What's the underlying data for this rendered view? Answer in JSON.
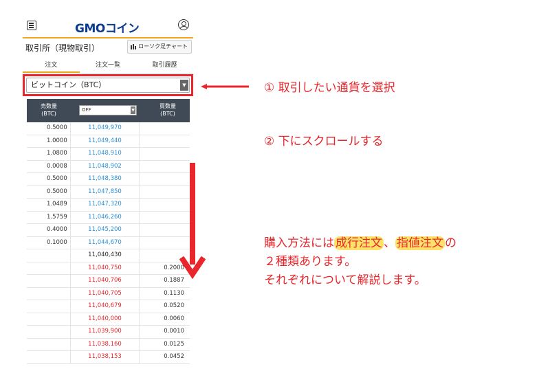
{
  "app": {
    "logo": "GMOコイン",
    "page_title": "取引所（現物取引）",
    "chart_button": "ローソク足チャート"
  },
  "tabs": [
    "注文",
    "注文一覧",
    "取引履歴"
  ],
  "pair": {
    "value": "ビットコイン（BTC）"
  },
  "orderbook": {
    "sell_header": [
      "売数量",
      "(BTC)"
    ],
    "buy_header": [
      "買数量",
      "(BTC)"
    ],
    "filter_value": "OFF",
    "asks": [
      {
        "qty": "0.5000",
        "price": "11,049,970"
      },
      {
        "qty": "1.0000",
        "price": "11,049,440"
      },
      {
        "qty": "1.0800",
        "price": "11,048,910"
      },
      {
        "qty": "0.0008",
        "price": "11,048,902"
      },
      {
        "qty": "0.5000",
        "price": "11,048,380"
      },
      {
        "qty": "0.5000",
        "price": "11,047,850"
      },
      {
        "qty": "1.0489",
        "price": "11,047,320"
      },
      {
        "qty": "1.5759",
        "price": "11,046,260"
      },
      {
        "qty": "0.4000",
        "price": "11,045,200"
      },
      {
        "qty": "0.1000",
        "price": "11,044,670"
      }
    ],
    "mid_price": "11,040,430",
    "bids": [
      {
        "price": "11,040,750",
        "qty": "0.2000"
      },
      {
        "price": "11,040,706",
        "qty": "0.1887"
      },
      {
        "price": "11,040,705",
        "qty": "0.1130"
      },
      {
        "price": "11,040,679",
        "qty": "0.0520"
      },
      {
        "price": "11,040,000",
        "qty": "0.0060"
      },
      {
        "price": "11,039,900",
        "qty": "0.0010"
      },
      {
        "price": "11,038,160",
        "qty": "0.0125"
      },
      {
        "price": "11,038,153",
        "qty": "0.0452"
      }
    ]
  },
  "annotations": {
    "step1": "①  取引したい通貨を選択",
    "step2": "②  下にスクロールする",
    "desc_prefix": "購入方法には",
    "market_order": "成行注文",
    "sep": "、",
    "limit_order": "指値注文",
    "desc_suffix": "の",
    "desc_line2": "２種類あります。",
    "desc_line3": "それぞれについて解説します。"
  },
  "colors": {
    "accent": "#f2a51a",
    "annotation_red": "#e8262b",
    "ask_blue": "#2c8fd6",
    "header_bg": "#3f4a56",
    "highlight_yellow": "#fde26a"
  }
}
